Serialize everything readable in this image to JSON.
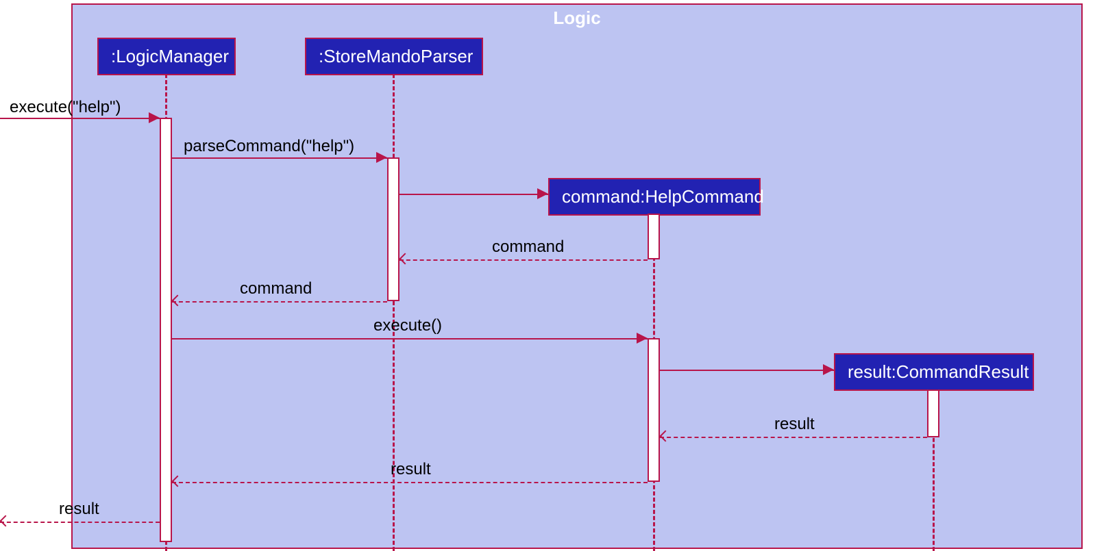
{
  "frame": {
    "title": "Logic"
  },
  "participants": {
    "logicManager": ":LogicManager",
    "storeMandoParser": ":StoreMandoParser",
    "helpCommand": "command:HelpCommand",
    "commandResult": "result:CommandResult"
  },
  "messages": {
    "executeHelp": "execute(\"help\")",
    "parseCommandHelp": "parseCommand(\"help\")",
    "commandReturn1": "command",
    "commandReturn2": "command",
    "executeCall": "execute()",
    "resultReturn1": "result",
    "resultReturn2": "result",
    "resultOut": "result"
  }
}
